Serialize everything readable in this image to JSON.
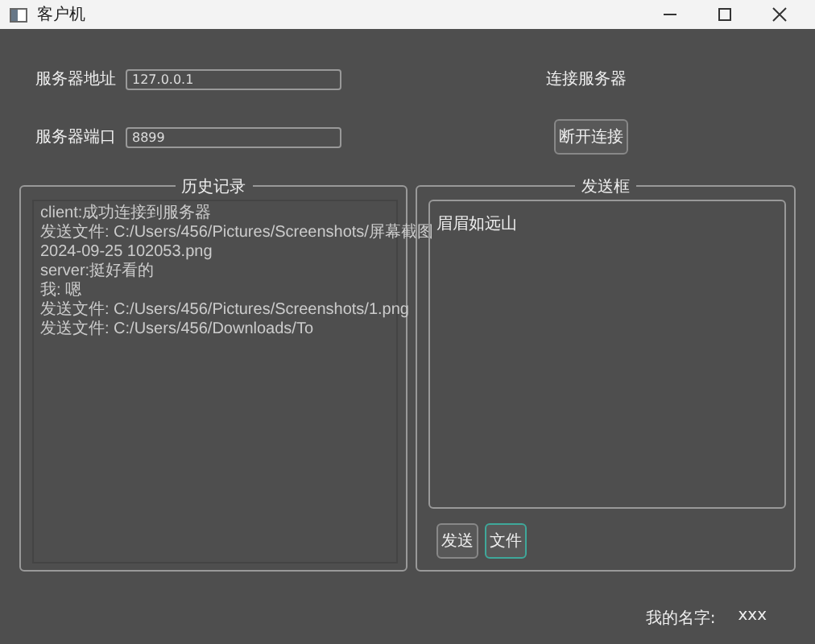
{
  "window": {
    "title": "客户机"
  },
  "server": {
    "address_label": "服务器地址",
    "address_value": "127.0.0.1",
    "port_label": "服务器端口",
    "port_value": "8899",
    "status": "连接服务器",
    "disconnect_button": "断开连接"
  },
  "history": {
    "title": "历史记录",
    "lines": [
      "client:成功连接到服务器",
      "发送文件: C:/Users/456/Pictures/Screenshots/屏幕截图",
      "2024-09-25 102053.png",
      "server:挺好看的",
      "我: 嗯",
      "发送文件: C:/Users/456/Pictures/Screenshots/1.png",
      "发送文件: C:/Users/456/Downloads/To"
    ]
  },
  "send": {
    "title": "发送框",
    "text": "眉眉如远山",
    "buttons": [
      {
        "label": "发送",
        "selected": false
      },
      {
        "label": "文件",
        "selected": true
      }
    ]
  },
  "name": {
    "label": "我的名字:",
    "value": "xxx"
  }
}
